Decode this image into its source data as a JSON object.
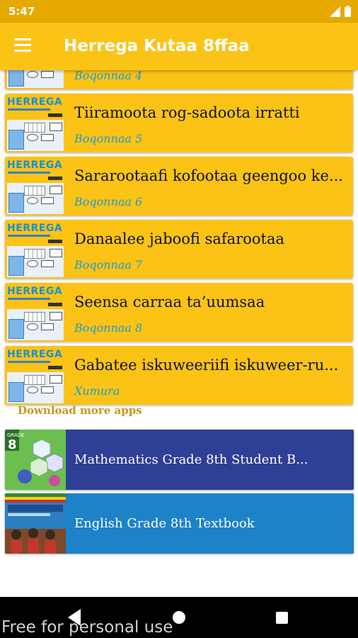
{
  "status_bar": {
    "time": "5:47"
  },
  "app_bar": {
    "title": "Herrega Kutaa 8ffaa"
  },
  "thumbnail_text": "HERREGA",
  "chapters": [
    {
      "title": "",
      "subtitle": "Boqonnaa 4"
    },
    {
      "title": "Tiiramoota rog-sadoota irratti",
      "subtitle": "Boqonnaa 5"
    },
    {
      "title": "Sararootaafi kofootaa geengoo ke...",
      "subtitle": "Boqonnaa 6"
    },
    {
      "title": "Danaalee jaboofi safarootaa",
      "subtitle": "Boqonnaa 7"
    },
    {
      "title": "Seensa carraa ta’uumsaa",
      "subtitle": "Boqonnaa 8"
    },
    {
      "title": "Gabatee iskuweeriifi iskuweer-ru...",
      "subtitle": "Xumura"
    }
  ],
  "download_section": {
    "header": "Download more apps",
    "apps": [
      {
        "name": "Mathematics Grade 8th Student B...",
        "color": "#2f3f95"
      },
      {
        "name": "English Grade 8th Textbook",
        "color": "#1e82c8"
      }
    ]
  },
  "watermark": "Free for personal use",
  "colors": {
    "primary": "#fbc316",
    "status": "#e5a900",
    "subtitle": "#1e9bd6"
  }
}
